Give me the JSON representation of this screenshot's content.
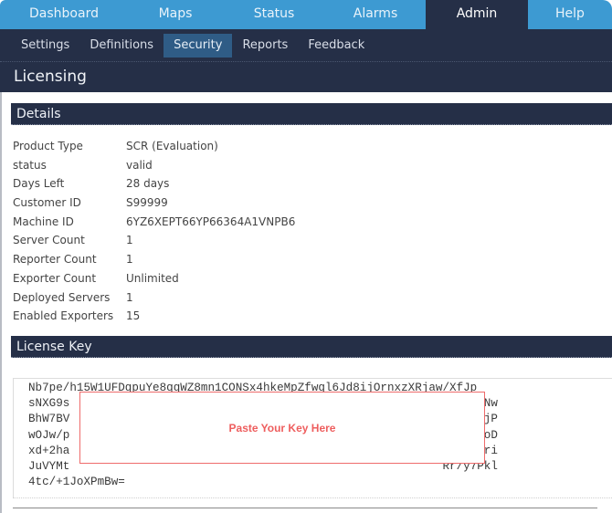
{
  "topnav": {
    "tabs": [
      {
        "label": "Dashboard",
        "active": false
      },
      {
        "label": "Maps",
        "active": false
      },
      {
        "label": "Status",
        "active": false
      },
      {
        "label": "Alarms",
        "active": false
      },
      {
        "label": "Admin",
        "active": true
      },
      {
        "label": "Help",
        "active": false
      }
    ]
  },
  "subnav": {
    "items": [
      {
        "label": "Settings",
        "active": false
      },
      {
        "label": "Definitions",
        "active": false
      },
      {
        "label": "Security",
        "active": true
      },
      {
        "label": "Reports",
        "active": false
      },
      {
        "label": "Feedback",
        "active": false
      }
    ]
  },
  "page": {
    "title": "Licensing"
  },
  "details": {
    "header": "Details",
    "rows": [
      {
        "label": "Product Type",
        "value": "SCR (Evaluation)"
      },
      {
        "label": "status",
        "value": "valid"
      },
      {
        "label": "Days Left",
        "value": "28 days"
      },
      {
        "label": "Customer ID",
        "value": "S99999"
      },
      {
        "label": "Machine ID",
        "value": "6YZ6XEPT66YP66364A1VNPB6"
      },
      {
        "label": "Server Count",
        "value": "1"
      },
      {
        "label": "Reporter Count",
        "value": "1"
      },
      {
        "label": "Exporter Count",
        "value": "Unlimited"
      },
      {
        "label": "Deployed Servers",
        "value": "1"
      },
      {
        "label": "Enabled Exporters",
        "value": "15"
      }
    ]
  },
  "license_key": {
    "header": "License Key",
    "lines": [
      "Nb7pe/h15W1UFDqpuYe8qqWZ8mn1CONSx4hkeMpZfwql6Jd8ijOrnxzXRjaw/XfJp",
      "sNXG9s                                                      DkeyR8Nw",
      "BhW7BV                                                      sq8h5GjP",
      "wOJw/p                                                      kwAeNwoD",
      "xd+2ha                                                      ph/HKdri",
      "JuVYMt                                                      Rr/y7Pkl",
      "4tc/+1JoXPmBw="
    ],
    "callout_text": "Paste Your Key Here",
    "callout_color": "#ee5e5e"
  },
  "colors": {
    "nav_blue": "#3d9ad2",
    "dark_navy": "#252f47",
    "subnav_active": "#2f5c86"
  }
}
